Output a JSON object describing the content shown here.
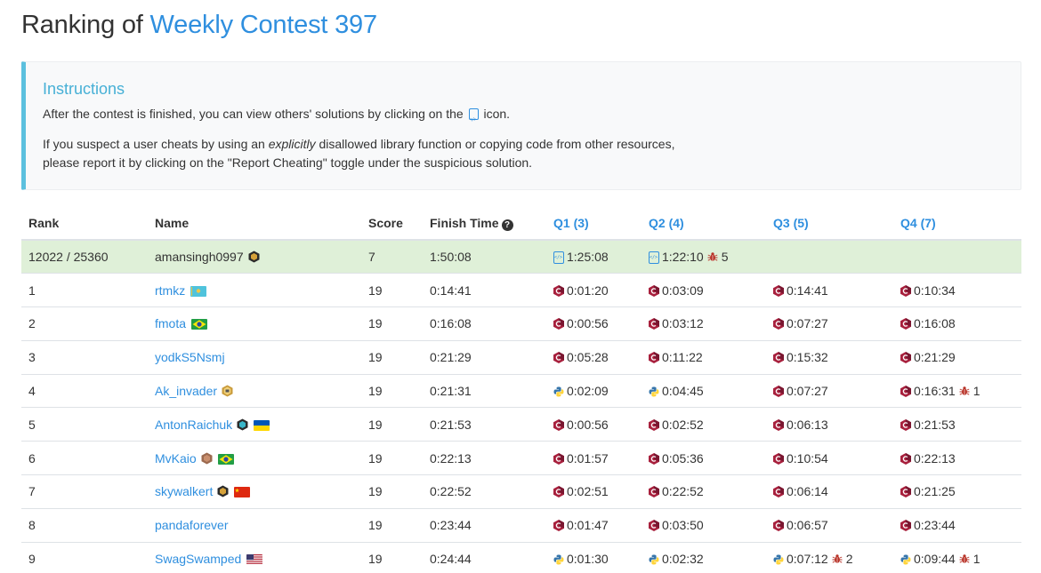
{
  "header": {
    "prefix": "Ranking of",
    "contest_name": "Weekly Contest 397"
  },
  "instructions": {
    "title": "Instructions",
    "line1_before": "After the contest is finished, you can view others' solutions by clicking on the",
    "line1_after": "icon.",
    "line2_before": "If you suspect a user cheats by using an",
    "line2_emph": "explicitly",
    "line2_after": "disallowed library function or copying code from other resources,",
    "line3": "please report it by clicking on the \"Report Cheating\" toggle under the suspicious solution."
  },
  "table": {
    "headers": {
      "rank": "Rank",
      "name": "Name",
      "score": "Score",
      "finish": "Finish Time",
      "q1": "Q1 (3)",
      "q2": "Q2 (4)",
      "q3": "Q3 (5)",
      "q4": "Q4 (7)"
    },
    "my_row": {
      "rank": "12022 / 25360",
      "name": "amansingh0997",
      "score": "7",
      "finish": "1:50:08",
      "q1": "1:25:08",
      "q2": "1:22:10",
      "q2_bugs": "5"
    },
    "rows": [
      {
        "rank": "1",
        "name": "rtmkz",
        "score": "19",
        "finish": "0:14:41",
        "q1": "0:01:20",
        "q2": "0:03:09",
        "q3": "0:14:41",
        "q4": "0:10:34"
      },
      {
        "rank": "2",
        "name": "fmota",
        "score": "19",
        "finish": "0:16:08",
        "q1": "0:00:56",
        "q2": "0:03:12",
        "q3": "0:07:27",
        "q4": "0:16:08"
      },
      {
        "rank": "3",
        "name": "yodkS5Nsmj",
        "score": "19",
        "finish": "0:21:29",
        "q1": "0:05:28",
        "q2": "0:11:22",
        "q3": "0:15:32",
        "q4": "0:21:29"
      },
      {
        "rank": "4",
        "name": "Ak_invader",
        "score": "19",
        "finish": "0:21:31",
        "q1": "0:02:09",
        "q2": "0:04:45",
        "q3": "0:07:27",
        "q4": "0:16:31",
        "q4_bugs": "1"
      },
      {
        "rank": "5",
        "name": "AntonRaichuk",
        "score": "19",
        "finish": "0:21:53",
        "q1": "0:00:56",
        "q2": "0:02:52",
        "q3": "0:06:13",
        "q4": "0:21:53"
      },
      {
        "rank": "6",
        "name": "MvKaio",
        "score": "19",
        "finish": "0:22:13",
        "q1": "0:01:57",
        "q2": "0:05:36",
        "q3": "0:10:54",
        "q4": "0:22:13"
      },
      {
        "rank": "7",
        "name": "skywalkert",
        "score": "19",
        "finish": "0:22:52",
        "q1": "0:02:51",
        "q2": "0:22:52",
        "q3": "0:06:14",
        "q4": "0:21:25"
      },
      {
        "rank": "8",
        "name": "pandaforever",
        "score": "19",
        "finish": "0:23:44",
        "q1": "0:01:47",
        "q2": "0:03:50",
        "q3": "0:06:57",
        "q4": "0:23:44"
      },
      {
        "rank": "9",
        "name": "SwagSwamped",
        "score": "19",
        "finish": "0:24:44",
        "q1": "0:01:30",
        "q2": "0:02:32",
        "q3": "0:07:12",
        "q3_bugs": "2",
        "q4": "0:09:44",
        "q4_bugs": "1"
      }
    ]
  },
  "colors": {
    "accent": "#2f8fdf",
    "instructions_border": "#5bc0de",
    "my_row_bg": "#dff0d8",
    "cpp_icon": "#b0304a",
    "bug_icon": "#c0392b"
  },
  "icons": {
    "solution": "code-file-icon",
    "cpp": "cpp-language-icon",
    "python": "python-language-icon",
    "bug": "bug-icon",
    "help": "question-circle-icon"
  }
}
